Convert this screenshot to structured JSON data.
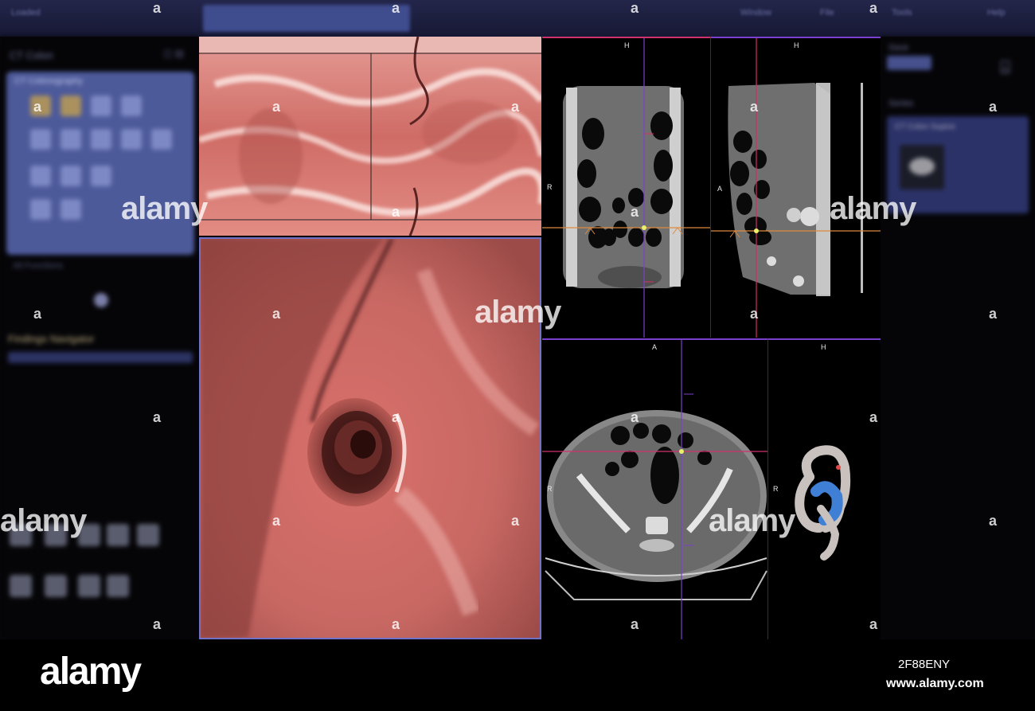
{
  "app": {
    "topbar_items": [
      "Loaded",
      "Window",
      "File",
      "Tools",
      "Help"
    ]
  },
  "left_panel": {
    "title": "CT Colon",
    "tools_header": "CT Colonography",
    "footer_text": "All Functions",
    "navigation_title": "Findings Navigator"
  },
  "right_panel": {
    "label_top": "Save",
    "label_series": "Series",
    "series_caption": "CT Colon Supine"
  },
  "viewports": {
    "coronal": {
      "top": "H",
      "left": "R"
    },
    "sagittal": {
      "top": "H",
      "left": "A"
    },
    "axial": {
      "top": "A",
      "left": "R"
    },
    "volume": {
      "top": "H",
      "left": "R"
    }
  },
  "colors": {
    "mucosa": "#d8736f",
    "coronal_line": "#d0306b",
    "crosshair_line": "#7b3fd0",
    "marker": "#f0a040"
  },
  "watermark": {
    "word": "alamy",
    "letter": "a"
  },
  "footer": {
    "brand": "alamy",
    "image_id": "2F88ENY",
    "url": "www.alamy.com"
  }
}
